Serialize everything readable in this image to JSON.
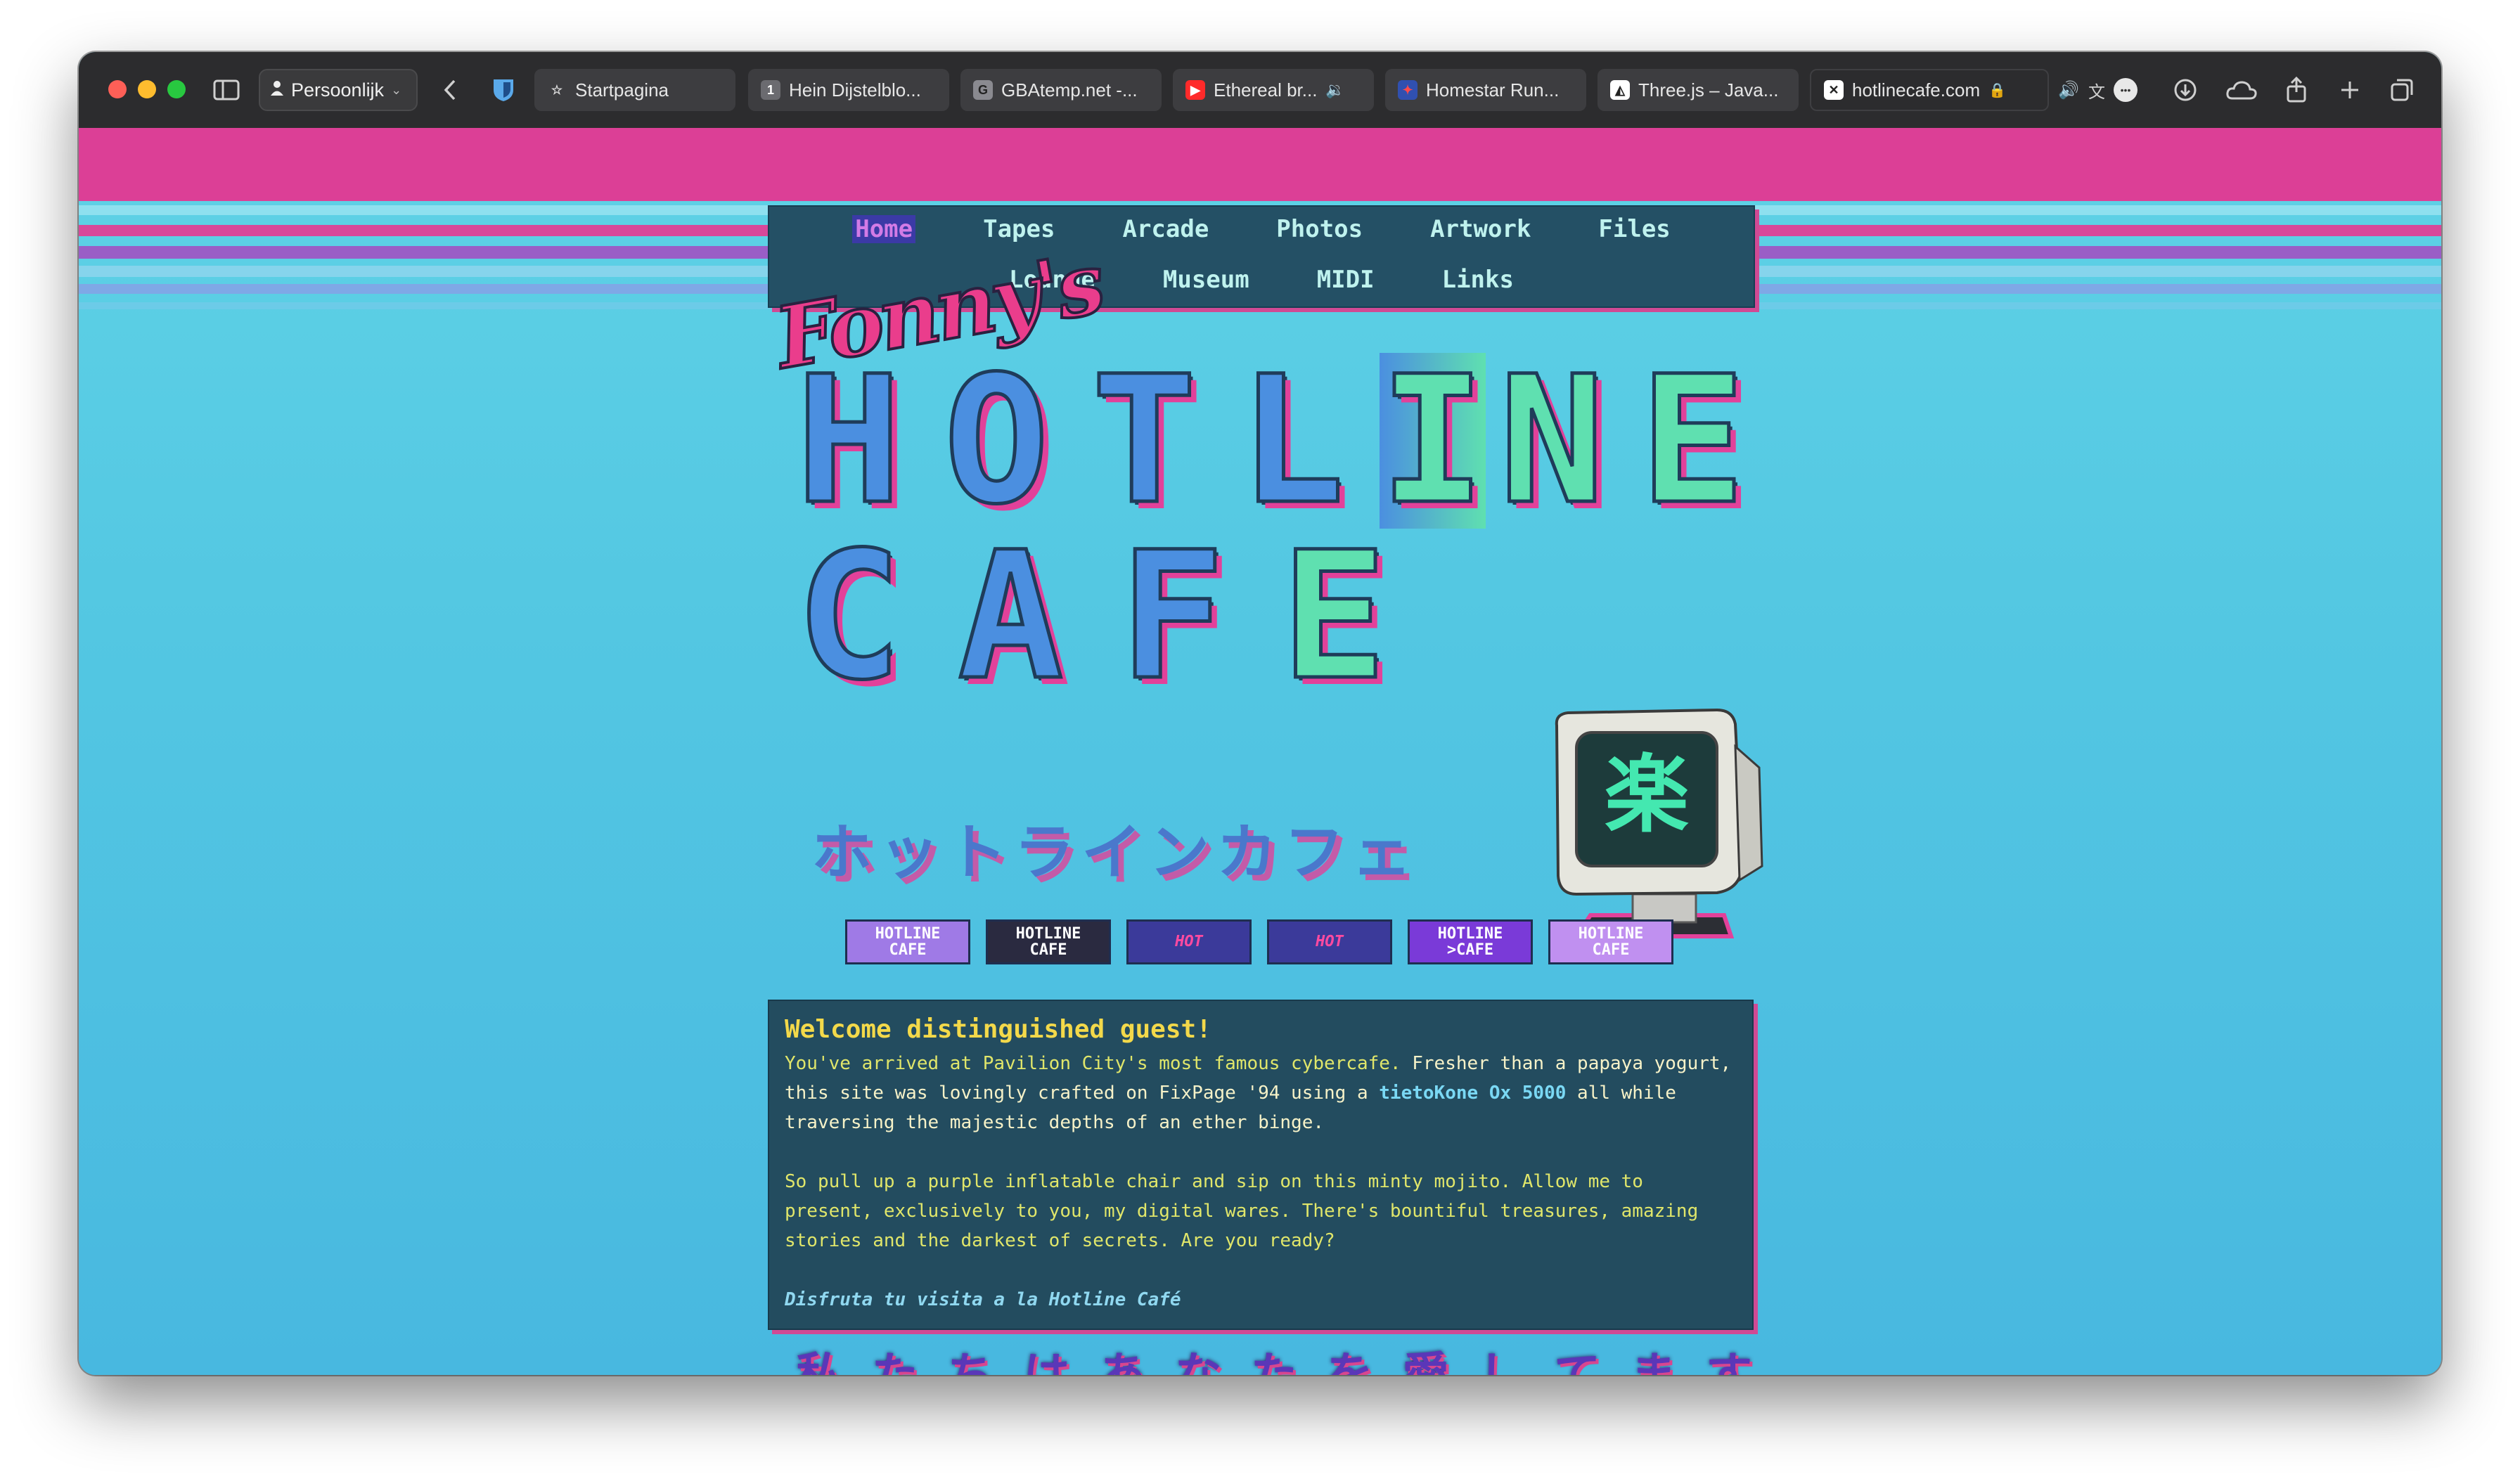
{
  "browser": {
    "profile_label": "Persoonlijk",
    "tabs": [
      {
        "label": "Startpagina",
        "icon": "star-icon"
      },
      {
        "label": "Hein Dijstelblo...",
        "icon": "number-1-icon"
      },
      {
        "label": "GBAtemp.net -...",
        "icon": "gbatemp-icon"
      },
      {
        "label": "Ethereal br...",
        "icon": "youtube-icon",
        "audio": true
      },
      {
        "label": "Homestar Run...",
        "icon": "homestar-icon"
      },
      {
        "label": "Three.js – Java...",
        "icon": "threejs-icon"
      },
      {
        "label": "hotlinecafe.com",
        "icon": "close-x-icon",
        "active": true
      }
    ]
  },
  "site": {
    "nav_row1": [
      "Home",
      "Tapes",
      "Arcade",
      "Photos",
      "Artwork",
      "Files"
    ],
    "nav_row2": [
      "Lounge",
      "Museum",
      "MIDI",
      "Links"
    ],
    "nav_active": "Home",
    "logo": {
      "script": "Fonny's",
      "line1": [
        "H",
        "O",
        "T",
        "L",
        "I",
        "N",
        "E"
      ],
      "line2": [
        "C",
        "A",
        "F",
        "E"
      ],
      "katakana": "ホットラインカフェ",
      "monitor_glyph": "楽"
    },
    "badges": [
      {
        "line1": "HOTLINE",
        "line2": "CAFE",
        "bg": "#9f7ae6"
      },
      {
        "line1": "HOTLINE",
        "line2": "CAFE",
        "bg": "#2a2a40"
      },
      {
        "line1": "",
        "line2": "HOT",
        "bg": "#3b3a9a"
      },
      {
        "line1": "",
        "line2": "HOT",
        "bg": "#3b3a9a"
      },
      {
        "line1": "HOTLINE",
        "line2": ">CAFE",
        "bg": "#7a3ad8"
      },
      {
        "line1": "HOTLINE",
        "line2": "CAFE",
        "bg": "#c090f0"
      }
    ],
    "welcome": {
      "heading": "Welcome distinguished guest!",
      "p1_part1": "You've arrived at Pavilion City's most famous cybercafe.",
      "p1_part2": " Fresher than a papaya yogurt, this site was lovingly crafted on FixPage '94 using a ",
      "p1_link": "tietoKone Ox 5000",
      "p1_part3": " all while traversing the majestic depths of an ether binge.",
      "p2": "So pull up a purple inflatable chair and sip on this minty mojito. Allow me to present, exclusively to you, my digital wares. There's bountiful treasures, amazing stories and the darkest of secrets. Are you ready?",
      "sign": "Disfruta tu visita a la Hotline Café"
    },
    "japanese_line": [
      "私",
      "た",
      "ち",
      "は",
      "あ",
      "な",
      "た",
      "を",
      "愛",
      "し",
      "て",
      "ま",
      "す"
    ]
  },
  "colors": {
    "pink_bar": "#dc3f96",
    "nav_bg": "#245065",
    "page_bg": "#53c7e2",
    "heading_yellow": "#f3d94a"
  }
}
